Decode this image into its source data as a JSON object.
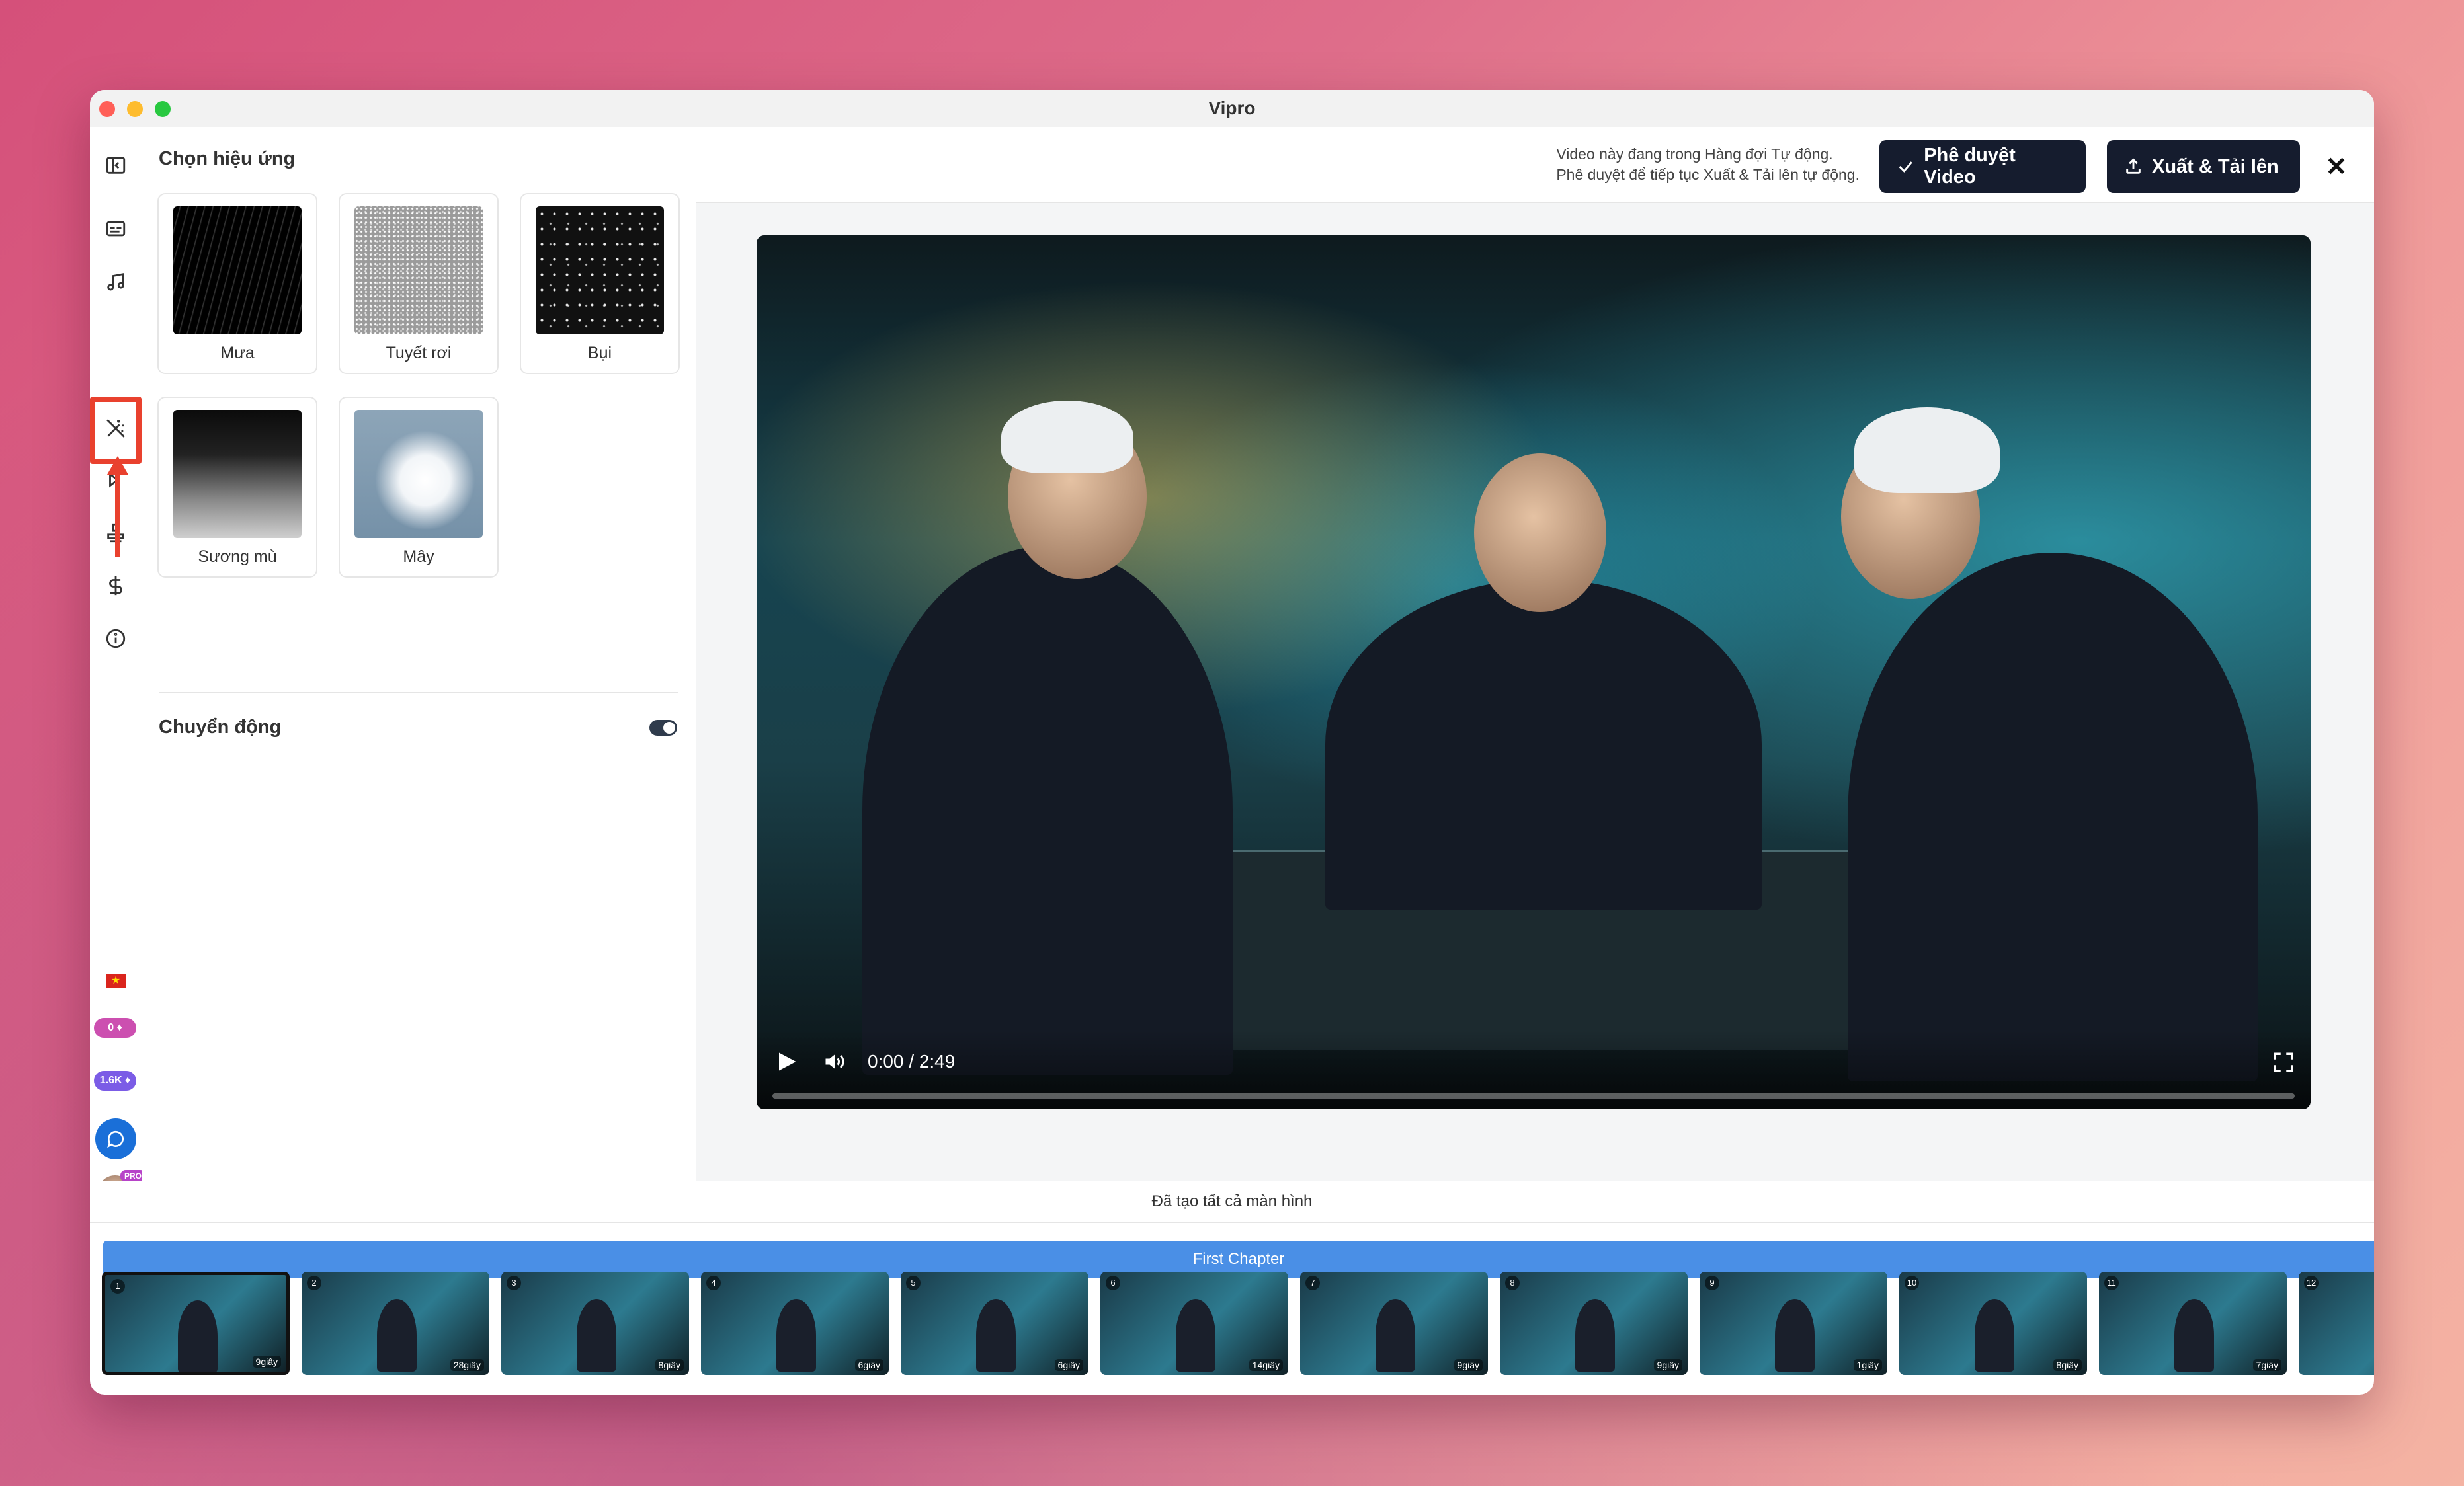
{
  "window": {
    "title": "Vipro"
  },
  "rail": {
    "items": [
      {
        "name": "collapse-sidebar-icon"
      },
      {
        "name": "subtitles-icon"
      },
      {
        "name": "music-icon"
      },
      {
        "name": "magic-wand-icon"
      },
      {
        "name": "transition-icon"
      },
      {
        "name": "stamp-icon"
      },
      {
        "name": "dollar-icon"
      },
      {
        "name": "info-icon"
      }
    ],
    "gems": "0",
    "credits": "1.6K",
    "pro_badge": "PRO"
  },
  "effects_panel": {
    "title": "Chọn hiệu ứng",
    "effects": [
      {
        "label": "Mưa",
        "style": "rain"
      },
      {
        "label": "Tuyết rơi",
        "style": "snow"
      },
      {
        "label": "Bụi",
        "style": "dust"
      },
      {
        "label": "Sương mù",
        "style": "fog"
      },
      {
        "label": "Mây",
        "style": "cloud"
      }
    ],
    "motion_label": "Chuyển động",
    "motion_enabled": true
  },
  "topbar": {
    "notice_line1": "Video này đang trong Hàng đợi Tự động.",
    "notice_line2": "Phê duyệt để tiếp tục Xuất & Tải lên tự động.",
    "approve_label": "Phê duyệt Video",
    "export_label": "Xuất & Tải lên"
  },
  "player": {
    "time": "0:00 / 2:49",
    "progress": 0
  },
  "status": {
    "text": "Đã tạo tất cả màn hình"
  },
  "chapter": {
    "label": "First Chapter"
  },
  "scenes": [
    {
      "num": "1",
      "duration": "9giây"
    },
    {
      "num": "2",
      "duration": "28giây"
    },
    {
      "num": "3",
      "duration": "8giây"
    },
    {
      "num": "4",
      "duration": "6giây"
    },
    {
      "num": "5",
      "duration": "6giây"
    },
    {
      "num": "6",
      "duration": "14giây"
    },
    {
      "num": "7",
      "duration": "9giây"
    },
    {
      "num": "8",
      "duration": "9giây"
    },
    {
      "num": "9",
      "duration": "1giây"
    },
    {
      "num": "10",
      "duration": "8giây"
    },
    {
      "num": "11",
      "duration": "7giây"
    },
    {
      "num": "12",
      "duration": ""
    }
  ],
  "colors": {
    "accent_dark": "#151c2e",
    "chapter_blue": "#4a8fe6",
    "highlight_red": "#e9412e"
  }
}
